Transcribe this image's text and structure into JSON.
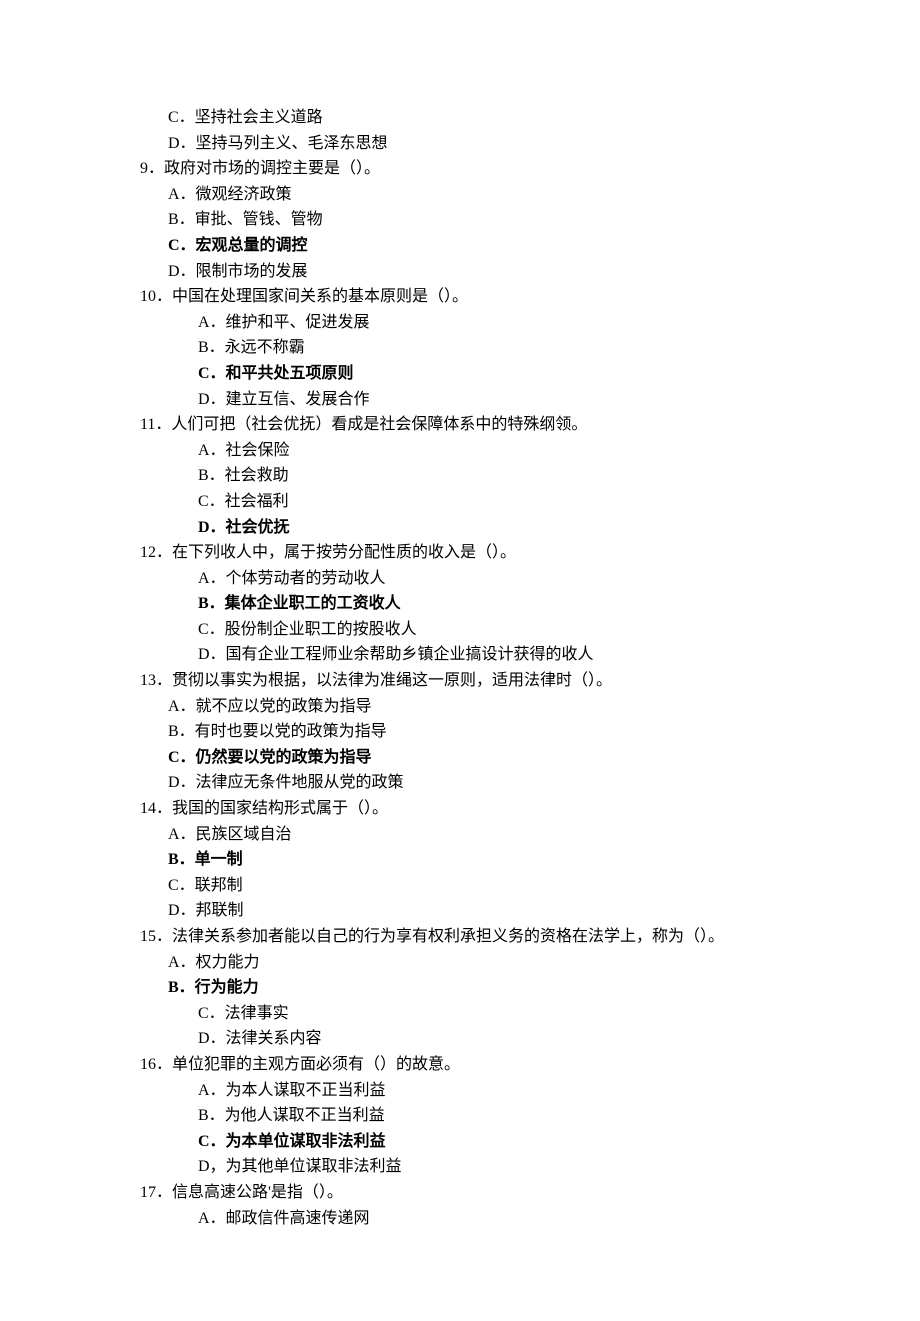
{
  "lines": {
    "l0": "C．坚持社会主义道路",
    "l1": "D．坚持马列主义、毛泽东思想",
    "q9": "9．政府对市场的调控主要是（）。",
    "q9a": "A．微观经济政策",
    "q9b": "B．审批、管钱、管物",
    "q9c": "C．宏观总量的调控",
    "q9d": "D．限制市场的发展",
    "q10": "10．中国在处理国家间关系的基本原则是（）。",
    "q10a": "A．维护和平、促进发展",
    "q10b": "B．永远不称霸",
    "q10c": "C．和平共处五项原则",
    "q10d": "D．建立互信、发展合作",
    "q11": "11．人们可把（社会优抚）看成是社会保障体系中的特殊纲领。",
    "q11a": "A．社会保险",
    "q11b": "B．社会救助",
    "q11c": "C．社会福利",
    "q11d": "D．社会优抚",
    "q12": "12．在下列收人中，属于按劳分配性质的收入是（）。",
    "q12a": "A．个体劳动者的劳动收人",
    "q12b": "B．集体企业职工的工资收人",
    "q12c": "C．股份制企业职工的按股收人",
    "q12d": "D．国有企业工程师业余帮助乡镇企业搞设计获得的收人",
    "q13": "13．贯彻以事实为根据，以法律为准绳这一原则，适用法律时（）。",
    "q13a": "A．就不应以党的政策为指导",
    "q13b": "B．有时也要以党的政策为指导",
    "q13c": "C．仍然要以党的政策为指导",
    "q13d": "D．法律应无条件地服从党的政策",
    "q14": "14．我国的国家结构形式属于（）。",
    "q14a": "A．民族区域自治",
    "q14b": "B．单一制",
    "q14c": "C．联邦制",
    "q14d": "D．邦联制",
    "q15": "15．法律关系参加者能以自己的行为享有权利承担义务的资格在法学上，称为（）。",
    "q15a": "A．权力能力",
    "q15b": "B．行为能力",
    "q15c": "C．法律事实",
    "q15d": "D．法律关系内容",
    "q16": "16．单位犯罪的主观方面必须有（）的故意。",
    "q16a": "A．为本人谋取不正当利益",
    "q16b": "B．为他人谋取不正当利益",
    "q16c": "C．为本单位谋取非法利益",
    "q16d": "D，为其他单位谋取非法利益",
    "q17": "17．信息高速公路'是指（）。",
    "q17a": "A．邮政信件高速传递网"
  }
}
